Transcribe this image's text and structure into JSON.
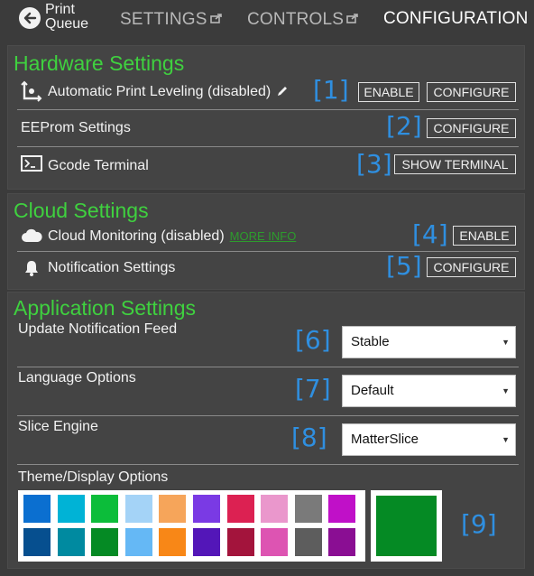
{
  "topbar": {
    "back_label_line1": "Print",
    "back_label_line2": "Queue",
    "tabs": [
      {
        "label": "SETTINGS"
      },
      {
        "label": "CONTROLS"
      },
      {
        "label": "CONFIGURATION"
      }
    ]
  },
  "hardware": {
    "title": "Hardware Settings",
    "rows": [
      {
        "label": "Automatic Print Leveling (disabled)",
        "marker": "[1]",
        "enable": "ENABLE",
        "configure": "CONFIGURE"
      },
      {
        "label": "EEProm Settings",
        "marker": "[2]",
        "configure": "CONFIGURE"
      },
      {
        "label": "Gcode Terminal",
        "marker": "[3]",
        "action": "SHOW TERMINAL"
      }
    ]
  },
  "cloud": {
    "title": "Cloud Settings",
    "rows": [
      {
        "label": "Cloud Monitoring (disabled)",
        "link": "MORE INFO",
        "marker": "[4]",
        "enable": "ENABLE"
      },
      {
        "label": "Notification Settings",
        "marker": "[5]",
        "configure": "CONFIGURE"
      }
    ]
  },
  "application": {
    "title": "Application Settings",
    "rows": [
      {
        "label": "Update Notification Feed",
        "marker": "[6]",
        "value": "Stable"
      },
      {
        "label": "Language Options",
        "marker": "[7]",
        "value": "Default"
      },
      {
        "label": "Slice Engine",
        "marker": "[8]",
        "value": "MatterSlice"
      }
    ],
    "theme": {
      "label": "Theme/Display Options",
      "marker": "[9]",
      "swatches_top": [
        "#0b6fd0",
        "#00b3d6",
        "#0cbd3a",
        "#a4d3f7",
        "#f6a55a",
        "#7a3ae4",
        "#dc2152",
        "#ea97cc",
        "#7a7a7a",
        "#c010c8"
      ],
      "swatches_bottom": [
        "#064f8f",
        "#008aa0",
        "#058a24",
        "#65b8f5",
        "#f88717",
        "#5316b8",
        "#a3143c",
        "#dd54b2",
        "#5d5d5d",
        "#8a0e93"
      ],
      "selected_color": "#058a24"
    }
  }
}
